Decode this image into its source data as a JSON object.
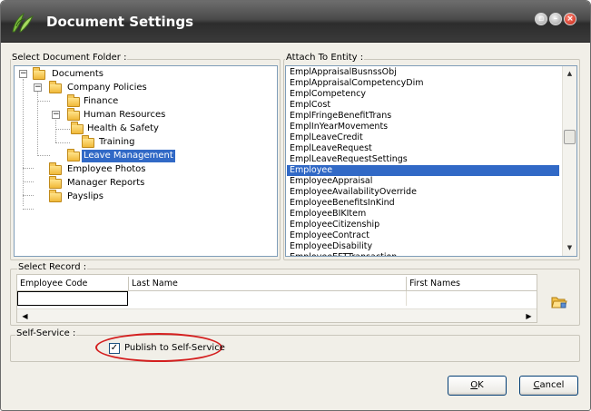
{
  "window": {
    "title": "Document Settings",
    "controls": [
      "restore-icon",
      "minimize-icon",
      "close-icon"
    ]
  },
  "folder_group": {
    "label": "Select Document Folder :",
    "tree": [
      {
        "label": "Documents",
        "level": 0,
        "expanded": true
      },
      {
        "label": "Company Policies",
        "level": 1,
        "expanded": true
      },
      {
        "label": "Finance",
        "level": 2
      },
      {
        "label": "Human Resources",
        "level": 2,
        "expanded": true
      },
      {
        "label": "Health & Safety",
        "level": 3
      },
      {
        "label": "Training",
        "level": 3
      },
      {
        "label": "Leave Management",
        "level": 2,
        "selected": true
      },
      {
        "label": "Employee Photos",
        "level": 1
      },
      {
        "label": "Manager Reports",
        "level": 1
      },
      {
        "label": "Payslips",
        "level": 1
      }
    ]
  },
  "entity_group": {
    "label": "Attach To Entity :",
    "items": [
      "EmplAppraisalBusnssObj",
      "EmplAppraisalCompetencyDim",
      "EmplCompetency",
      "EmplCost",
      "EmplFringeBenefitTrans",
      "EmplInYearMovements",
      "EmplLeaveCredit",
      "EmplLeaveRequest",
      "EmplLeaveRequestSettings",
      "Employee",
      "EmployeeAppraisal",
      "EmployeeAvailabilityOverride",
      "EmployeeBenefitsInKind",
      "EmployeeBIKItem",
      "EmployeeCitizenship",
      "EmployeeContract",
      "EmployeeDisability",
      "EmployeeEFTTransaction"
    ],
    "selected": "Employee"
  },
  "record_group": {
    "label": "Select Record :",
    "columns": [
      "Employee Code",
      "Last Name",
      "First Names"
    ]
  },
  "self_service": {
    "label": "Self-Service :",
    "checkbox_label": "Publish to Self-Service",
    "checked": true,
    "check_mark": "✓"
  },
  "buttons": {
    "ok_accel": "O",
    "ok_rest": "K",
    "cancel_accel": "C",
    "cancel_rest": "ancel"
  },
  "colors": {
    "selection": "#3169c6",
    "highlight_oval": "#d41f1f"
  }
}
